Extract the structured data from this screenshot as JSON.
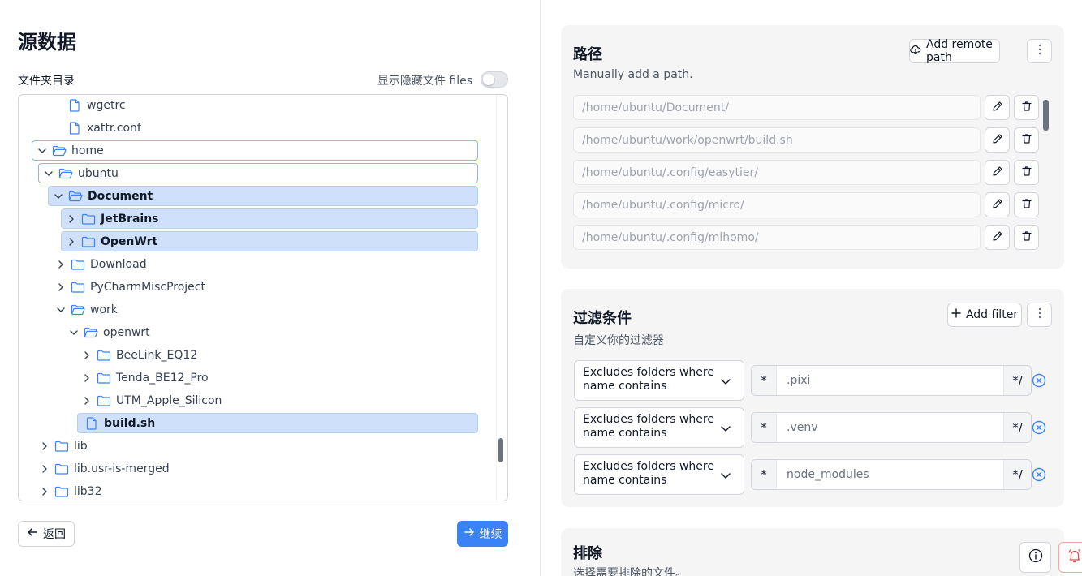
{
  "left": {
    "title": "源数据",
    "tree_label": "文件夹目录",
    "hidden_toggle_label": "显示隐藏文件 files",
    "tree": [
      {
        "label": "wgetrc",
        "type": "file"
      },
      {
        "label": "xattr.conf",
        "type": "file"
      },
      {
        "label": "home",
        "type": "folder",
        "expanded": true
      },
      {
        "label": "ubuntu",
        "type": "folder",
        "expanded": true
      },
      {
        "label": "Document",
        "type": "folder",
        "expanded": true
      },
      {
        "label": "JetBrains",
        "type": "folder",
        "expanded": false
      },
      {
        "label": "OpenWrt",
        "type": "folder",
        "expanded": false
      },
      {
        "label": "Download",
        "type": "folder",
        "expanded": false
      },
      {
        "label": "PyCharmMiscProject",
        "type": "folder",
        "expanded": false
      },
      {
        "label": "work",
        "type": "folder",
        "expanded": true
      },
      {
        "label": "openwrt",
        "type": "folder",
        "expanded": true
      },
      {
        "label": "BeeLink_EQ12",
        "type": "folder",
        "expanded": false
      },
      {
        "label": "Tenda_BE12_Pro",
        "type": "folder",
        "expanded": false
      },
      {
        "label": "UTM_Apple_Silicon",
        "type": "folder",
        "expanded": false
      },
      {
        "label": "build.sh",
        "type": "file"
      },
      {
        "label": "lib",
        "type": "folder",
        "expanded": false
      },
      {
        "label": "lib.usr-is-merged",
        "type": "folder",
        "expanded": false
      },
      {
        "label": "lib32",
        "type": "folder",
        "expanded": false
      }
    ],
    "back_label": "返回",
    "continue_label": "继续"
  },
  "paths": {
    "title": "路径",
    "description": "Manually add a path.",
    "add_label": "Add remote path",
    "items": [
      "/home/ubuntu/Document/",
      "/home/ubuntu/work/openwrt/build.sh",
      "/home/ubuntu/.config/easytier/",
      "/home/ubuntu/.config/micro/",
      "/home/ubuntu/.config/mihomo/"
    ]
  },
  "filters": {
    "title": "过滤条件",
    "description": "自定义你的过滤器",
    "add_label": "Add filter",
    "items": [
      {
        "condition_line1": "Excludes folders where",
        "condition_line2": "name contains",
        "prefix": "*",
        "value": ".pixi",
        "suffix": "*/"
      },
      {
        "condition_line1": "Excludes folders where",
        "condition_line2": "name contains",
        "prefix": "*",
        "value": ".venv",
        "suffix": "*/"
      },
      {
        "condition_line1": "Excludes folders where",
        "condition_line2": "name contains",
        "prefix": "*",
        "value": "node_modules",
        "suffix": "*/"
      }
    ]
  },
  "exclude": {
    "title": "排除",
    "description": "选择需要排除的文件。"
  },
  "colors": {
    "accent": "#3b82f6",
    "selection": "#cfe0fa",
    "danger": "#ef4444"
  }
}
